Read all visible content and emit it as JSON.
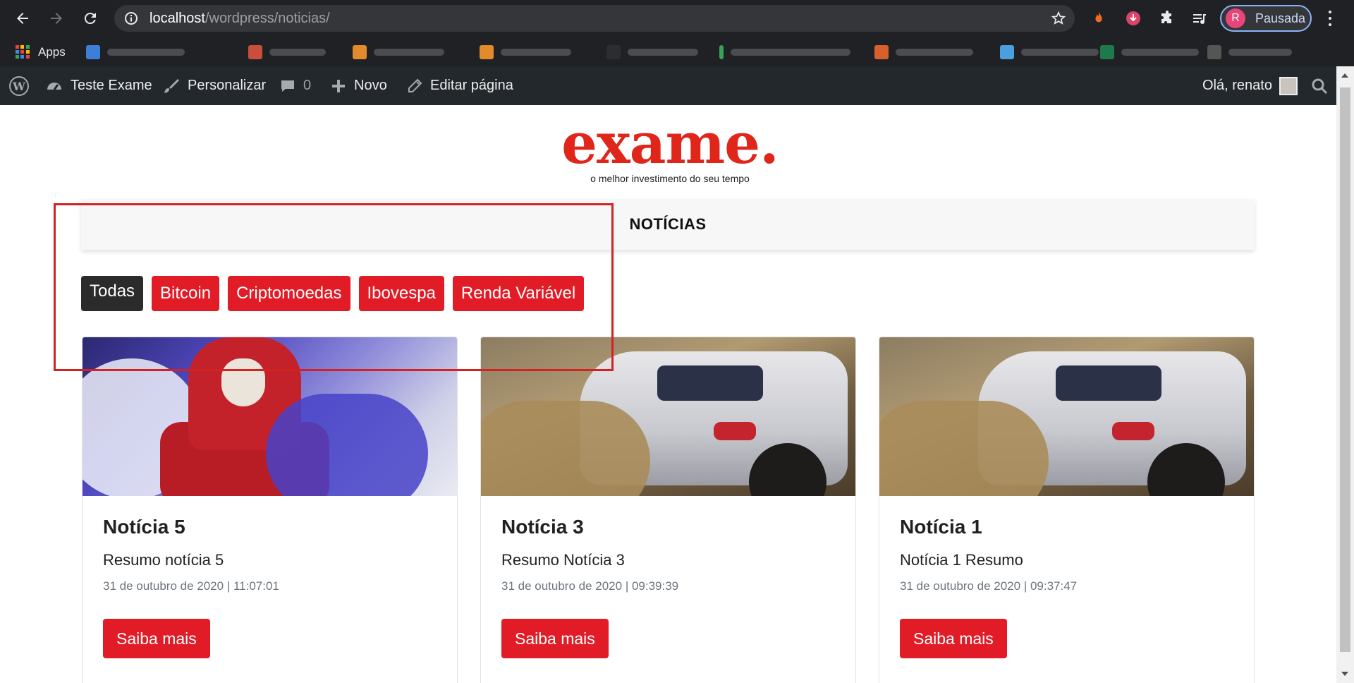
{
  "browser": {
    "url_host": "localhost",
    "url_path": "/wordpress/noticias/",
    "profile_initial": "R",
    "profile_status": "Pausada",
    "bookmarks": {
      "apps_label": "Apps"
    }
  },
  "admin_bar": {
    "site_name": "Teste Exame",
    "customize": "Personalizar",
    "comments_count": "0",
    "new": "Novo",
    "edit_page": "Editar página",
    "greeting": "Olá, renato"
  },
  "site": {
    "logo_text": "exame.",
    "tagline": "o melhor investimento do seu tempo"
  },
  "section": {
    "title": "NOTÍCIAS"
  },
  "filters": [
    {
      "label": "Todas",
      "active": true
    },
    {
      "label": "Bitcoin",
      "active": false
    },
    {
      "label": "Criptomoedas",
      "active": false
    },
    {
      "label": "Ibovespa",
      "active": false
    },
    {
      "label": "Renda Variável",
      "active": false
    }
  ],
  "posts": [
    {
      "title": "Notícia 5",
      "summary": "Resumo notícia 5",
      "date": "31 de outubro de 2020 | 11:07:01",
      "button": "Saiba mais"
    },
    {
      "title": "Notícia 3",
      "summary": "Resumo Notícia 3",
      "date": "31 de outubro de 2020 | 09:39:39",
      "button": "Saiba mais"
    },
    {
      "title": "Notícia 1",
      "summary": "Notícia 1 Resumo",
      "date": "31 de outubro de 2020 | 09:37:47",
      "button": "Saiba mais"
    }
  ],
  "colors": {
    "brand_red": "#e21c26",
    "active_chip": "#2b2b2b",
    "admin_bar": "#23282d",
    "chrome_bg": "#202124",
    "annotation_box": "#d42222"
  }
}
